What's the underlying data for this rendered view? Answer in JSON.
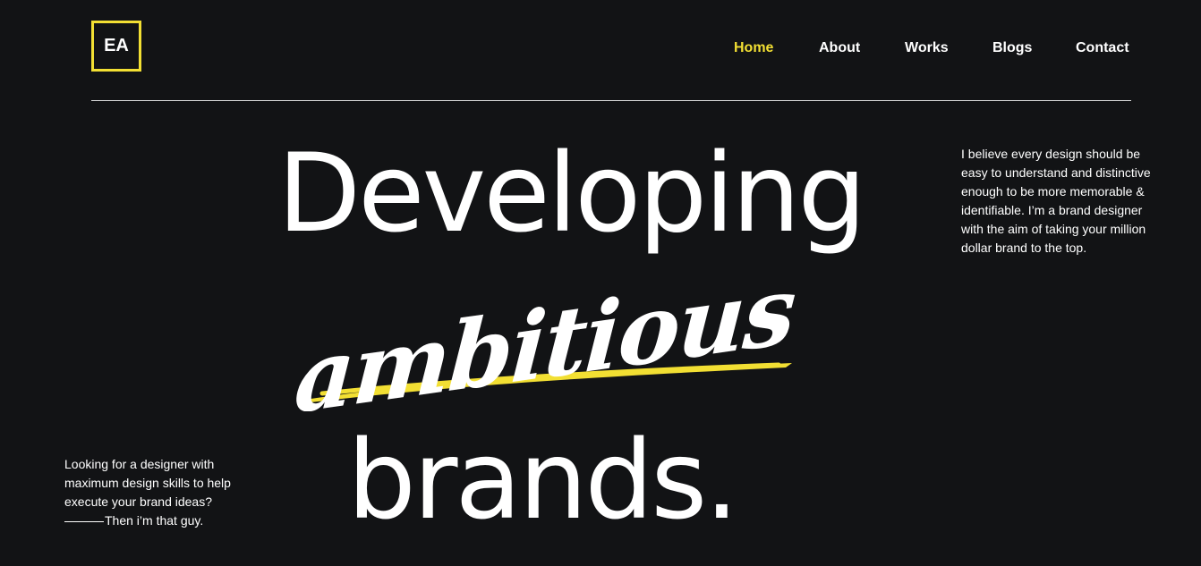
{
  "brand": {
    "logo_text": "EA",
    "accent_color": "#f2df33",
    "background_color": "#121315"
  },
  "nav": {
    "items": [
      {
        "label": "Home",
        "active": true
      },
      {
        "label": "About",
        "active": false
      },
      {
        "label": "Works",
        "active": false
      },
      {
        "label": "Blogs",
        "active": false
      },
      {
        "label": "Contact",
        "active": false
      }
    ]
  },
  "hero": {
    "line1": "Developing",
    "script_word": "ambitious",
    "line3": "brands.",
    "right_copy": "I believe every design should be easy to understand and distinctive enough to be more memorable & identifiable. I’m a brand designer with the aim of taking your million dollar brand to the top.",
    "left_copy": "Looking for a designer with maximum design skills to help execute your brand ideas?",
    "left_tagline": "Then i’m that guy."
  }
}
